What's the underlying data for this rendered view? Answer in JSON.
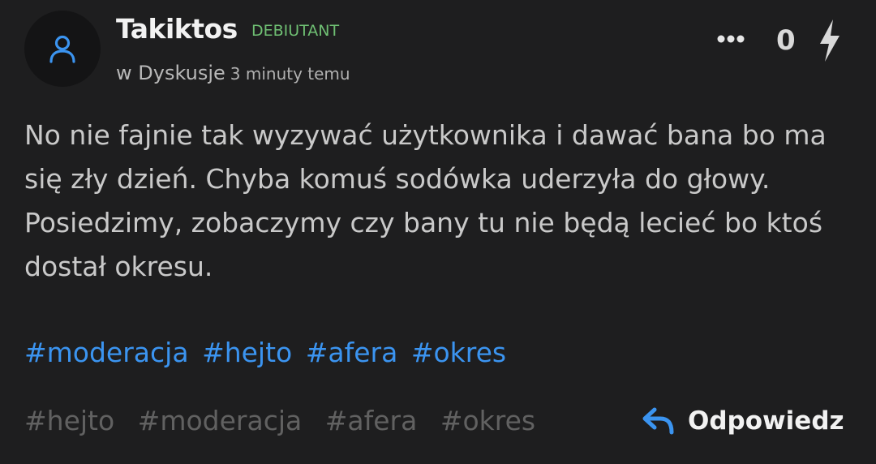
{
  "post": {
    "author": {
      "username": "Takiktos",
      "rank": "DEBIUTANT",
      "avatar_icon": "user-icon"
    },
    "location": {
      "prefix": "w Dyskusje",
      "time": "3 minuty temu"
    },
    "actions": {
      "more_icon": "more-dots-icon",
      "score": "0",
      "vote_icon": "lightning-icon"
    },
    "content": "No nie fajnie tak wyzywać użytkownika i dawać bana bo ma się zły dzień. Chyba komuś sodówka uderzyła do głowy. Posiedzimy, zobaczymy czy bany tu nie będą lecieć bo ktoś dostał okresu.",
    "hashtags": [
      "#moderacja",
      "#hejto",
      "#afera",
      "#okres"
    ],
    "tags": [
      "#hejto",
      "#moderacja",
      "#afera",
      "#okres"
    ],
    "reply": {
      "label": "Odpowiedz",
      "icon": "reply-arrow-icon"
    }
  },
  "colors": {
    "background": "#1e1e1f",
    "rank": "#6fbf73",
    "hashtag": "#3b94f0",
    "tag": "#616161",
    "accent_icon": "#3b94f0"
  }
}
